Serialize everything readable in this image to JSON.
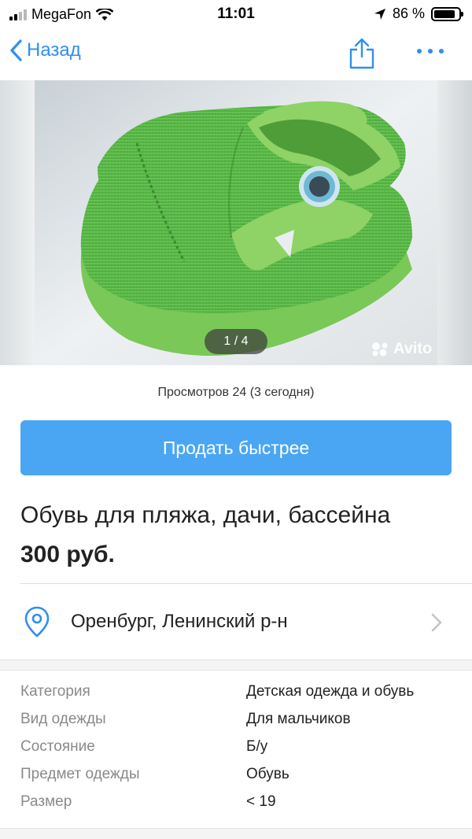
{
  "status_bar": {
    "carrier": "MegaFon",
    "time": "11:01",
    "battery": "86 %",
    "battery_level": 0.86
  },
  "nav": {
    "back_label": "Назад"
  },
  "gallery": {
    "pager": "1 / 4",
    "watermark": "Avito"
  },
  "views": "Просмотров 24 (3 сегодня)",
  "sell_button": "Продать быстрее",
  "listing": {
    "title": "Обувь для пляжа, дачи, бассейна",
    "price": "300 руб."
  },
  "location": {
    "text": "Оренбург, Ленинский р-н"
  },
  "params": [
    {
      "label": "Категория",
      "value": "Детская одежда и обувь"
    },
    {
      "label": "Вид одежды",
      "value": "Для мальчиков"
    },
    {
      "label": "Состояние",
      "value": "Б/у"
    },
    {
      "label": "Предмет одежды",
      "value": "Обувь"
    },
    {
      "label": "Размер",
      "value": "< 19"
    }
  ],
  "colors": {
    "accent": "#2f8ff0",
    "button": "#4aa6f3",
    "shoe_green": "#5cbf45"
  }
}
